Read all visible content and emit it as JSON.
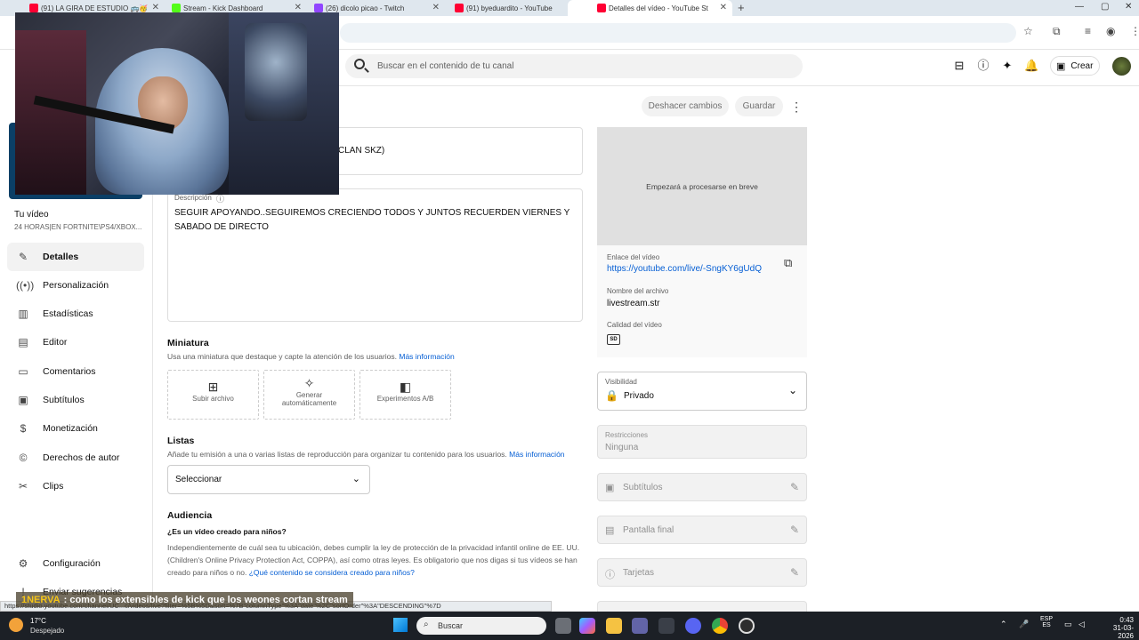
{
  "browser": {
    "tabs": [
      {
        "title": "(91) LA GIRA DE ESTUDIO 🚌🥳",
        "favicon_color": "#ff0033"
      },
      {
        "title": "Stream - Kick Dashboard",
        "favicon_color": "#53fc18"
      },
      {
        "title": "(26) dicolo picao - Twitch",
        "favicon_color": "#9146ff"
      },
      {
        "title": "(91) byeduardito - YouTube",
        "favicon_color": "#ff0033"
      },
      {
        "title": "Detalles del vídeo - YouTube St",
        "favicon_color": "#ff0033"
      }
    ],
    "new_tab": "+",
    "status_url": "https://studio.youtube.com/channel/UC...c/videos/live?filter=%5B%5D&sort=%7B\"columnType\"%3A\"date\"%2C\"sortOrder\"%3A\"DESCENDING\"%7D"
  },
  "header": {
    "search_placeholder": "Buscar en el contenido de tu canal",
    "create_label": "Crear"
  },
  "sidebar": {
    "your_video": "Tu vídeo",
    "video_subtitle": "24 HORAS|EN FORTNITE\\PS4/XBOX...",
    "items": [
      {
        "label": "Detalles",
        "icon": "pencil-icon",
        "active": true
      },
      {
        "label": "Personalización",
        "icon": "broadcast-icon"
      },
      {
        "label": "Estadísticas",
        "icon": "analytics-icon"
      },
      {
        "label": "Editor",
        "icon": "editor-icon"
      },
      {
        "label": "Comentarios",
        "icon": "comments-icon"
      },
      {
        "label": "Subtítulos",
        "icon": "subtitles-icon"
      },
      {
        "label": "Monetización",
        "icon": "dollar-icon"
      },
      {
        "label": "Derechos de autor",
        "icon": "copyright-icon"
      },
      {
        "label": "Clips",
        "icon": "scissors-icon"
      }
    ],
    "settings": "Configuración",
    "feedback": "Enviar sugerencias"
  },
  "actions": {
    "undo": "Deshacer cambios",
    "save": "Guardar"
  },
  "form": {
    "title_value_fragment": "CLAN SKZ)",
    "description_label": "Descripción",
    "description_value": "SEGUIR APOYANDO..SEGUIREMOS CRECIENDO TODOS Y JUNTOS RECUERDEN VIERNES Y SABADO DE DIRECTO",
    "thumbnail": {
      "title": "Miniatura",
      "subtitle": "Usa una miniatura que destaque y capte la atención de los usuarios.",
      "more_info": "Más información",
      "options": [
        "Subir archivo",
        "Generar automáticamente",
        "Experimentos A/B"
      ]
    },
    "playlists": {
      "title": "Listas",
      "subtitle": "Añade tu emisión a una o varias listas de reproducción para organizar tu contenido para los usuarios.",
      "more_info": "Más información",
      "select_value": "Seleccionar"
    },
    "audience": {
      "title": "Audiencia",
      "question": "¿Es un vídeo creado para niños?",
      "text": "Independientemente de cuál sea tu ubicación, debes cumplir la ley de protección de la privacidad infantil online de EE. UU. (Children's Online Privacy Protection Act, COPPA), así como otras leyes. Es obligatorio que nos digas si tus vídeos se han creado para niños o no.",
      "link": "¿Qué contenido se considera creado para niños?"
    }
  },
  "right_panel": {
    "processing": "Empezará a procesarse en breve",
    "link_label": "Enlace del vídeo",
    "link_value": "https://youtube.com/live/-SngKY6gUdQ",
    "filename_label": "Nombre del archivo",
    "filename_value": "livestream.str",
    "quality_label": "Calidad del vídeo",
    "quality_badge": "SD",
    "visibility_label": "Visibilidad",
    "visibility_value": "Privado",
    "restrictions_label": "Restricciones",
    "restrictions_value": "Ninguna",
    "subtitles": "Subtítulos",
    "end_screen": "Pantalla final",
    "cards": "Tarjetas"
  },
  "chat_overlay": {
    "user": "1NERVA",
    "message": ": como los extensibles de kick que los weones cortan stream"
  },
  "taskbar": {
    "temperature": "17°C",
    "weather": "Despejado",
    "search": "Buscar",
    "lang_top": "ESP",
    "lang_bottom": "ES",
    "time": "0:43",
    "date": "31-03-2026"
  }
}
